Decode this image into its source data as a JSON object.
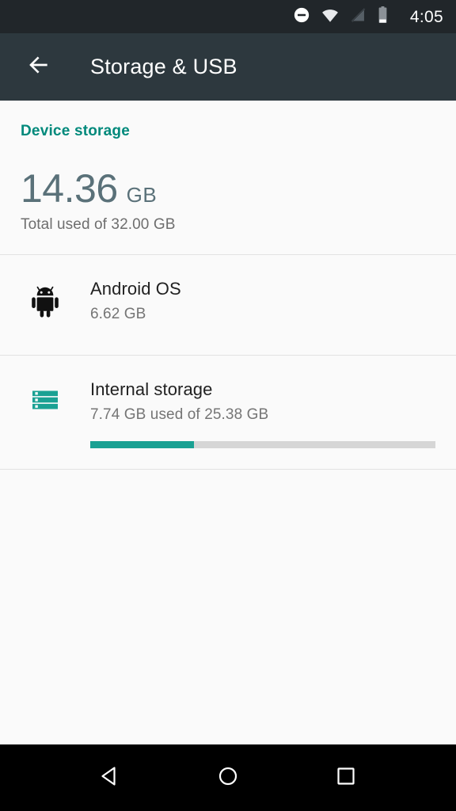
{
  "status_bar": {
    "time": "4:05",
    "icons": [
      {
        "name": "do-not-disturb-icon",
        "label": "Do not disturb"
      },
      {
        "name": "wifi-icon",
        "label": "Wi-Fi connected"
      },
      {
        "name": "no-sim-icon",
        "label": "No SIM / signal off"
      },
      {
        "name": "battery-icon",
        "label": "Battery low"
      }
    ],
    "background_color": "#21262a"
  },
  "toolbar": {
    "title": "Storage & USB",
    "back_icon": "arrow-back-icon",
    "background_color": "#2d383e",
    "text_color": "#ffffff"
  },
  "device_storage": {
    "section_title": "Device storage",
    "total_used_value": "14.36",
    "total_used_unit": "GB",
    "total_used_caption": "Total used of 32.00 GB",
    "accent_color": "#00897b",
    "value_color": "#5a7179"
  },
  "storage_items": [
    {
      "icon": "android-robot-icon",
      "title": "Android OS",
      "subtitle": "6.62 GB",
      "has_progress": false
    },
    {
      "icon": "internal-storage-icon",
      "title": "Internal storage",
      "subtitle": "7.74 GB used of 25.38 GB",
      "has_progress": true,
      "progress_percent": 30,
      "progress_fill_color": "#1aa193",
      "progress_track_color": "#d6d6d6"
    }
  ],
  "nav_bar": {
    "background_color": "#000000",
    "buttons": [
      {
        "name": "nav-back-button",
        "label": "Back"
      },
      {
        "name": "nav-home-button",
        "label": "Home"
      },
      {
        "name": "nav-recents-button",
        "label": "Recents"
      }
    ]
  }
}
